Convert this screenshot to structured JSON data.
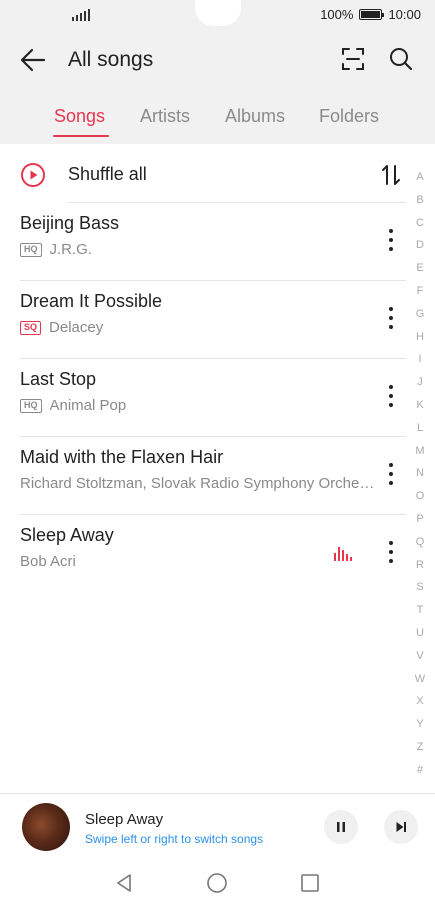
{
  "status_bar": {
    "battery_text": "100%",
    "time": "10:00",
    "battery_level": 1.0
  },
  "header": {
    "title": "All songs",
    "back_icon": "arrow-left-icon",
    "scan_icon": "scan-icon",
    "search_icon": "search-icon"
  },
  "tabs": [
    {
      "label": "Songs",
      "active": true
    },
    {
      "label": "Artists",
      "active": false
    },
    {
      "label": "Albums",
      "active": false
    },
    {
      "label": "Folders",
      "active": false
    }
  ],
  "shuffle": {
    "label": "Shuffle all"
  },
  "songs": [
    {
      "title": "Beijing Bass",
      "badge": "HQ",
      "artist": "J.R.G."
    },
    {
      "title": "Dream It Possible",
      "badge": "SQ",
      "artist": "Delacey"
    },
    {
      "title": "Last Stop",
      "badge": "HQ",
      "artist": "Animal Pop"
    },
    {
      "title": "Maid with the Flaxen Hair",
      "badge": "",
      "artist": "Richard Stoltzman, Slovak Radio Symphony Orche…"
    },
    {
      "title": "Sleep Away",
      "badge": "",
      "artist": "Bob Acri",
      "playing": true
    }
  ],
  "alpha_index": [
    "A",
    "B",
    "C",
    "D",
    "E",
    "F",
    "G",
    "H",
    "I",
    "J",
    "K",
    "L",
    "M",
    "N",
    "O",
    "P",
    "Q",
    "R",
    "S",
    "T",
    "U",
    "V",
    "W",
    "X",
    "Y",
    "Z",
    "#"
  ],
  "mini_player": {
    "title": "Sleep Away",
    "hint": "Swipe left or right to switch songs"
  },
  "colors": {
    "accent": "#e8364f",
    "hint_blue": "#2b90e8",
    "header_bg": "#f1f1f1"
  }
}
